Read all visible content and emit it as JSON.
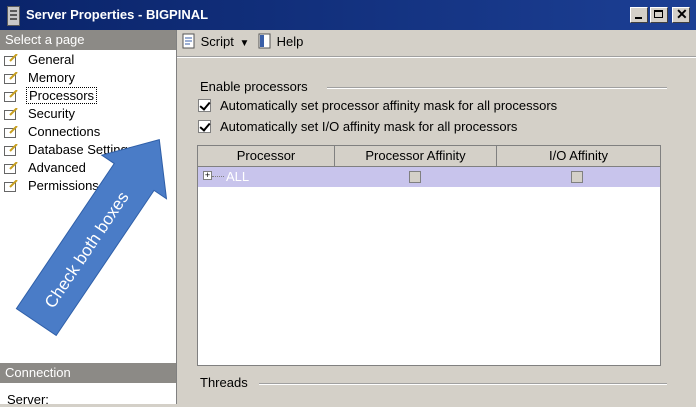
{
  "window": {
    "title": "Server Properties - BIGPINAL"
  },
  "left_pane": {
    "select_header": "Select a page",
    "pages": [
      {
        "label": "General"
      },
      {
        "label": "Memory"
      },
      {
        "label": "Processors",
        "selected": true
      },
      {
        "label": "Security"
      },
      {
        "label": "Connections"
      },
      {
        "label": "Database Settings"
      },
      {
        "label": "Advanced"
      },
      {
        "label": "Permissions"
      }
    ],
    "connection_header": "Connection",
    "server_label": "Server:"
  },
  "toolbar": {
    "script_label": "Script",
    "help_label": "Help"
  },
  "processors": {
    "group_title": "Enable processors",
    "auto_processor_affinity": {
      "label": "Automatically set processor affinity mask for all processors",
      "checked": true
    },
    "auto_io_affinity": {
      "label": "Automatically set I/O affinity mask for all processors",
      "checked": true
    },
    "grid": {
      "columns": [
        "Processor",
        "Processor Affinity",
        "I/O Affinity"
      ],
      "rows": [
        {
          "processor": "ALL",
          "processor_affinity": false,
          "io_affinity": false
        }
      ]
    },
    "threads_title": "Threads"
  },
  "annotation": {
    "text": "Check both boxes",
    "color": "#4a7cc7"
  }
}
